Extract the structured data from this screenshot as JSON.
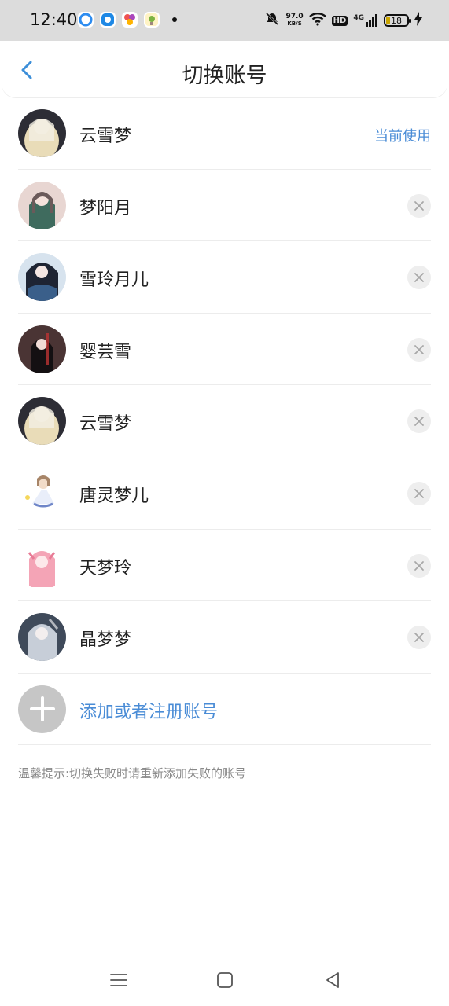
{
  "status_bar": {
    "time": "12:40",
    "speed_value": "97.0",
    "speed_unit": "KB/S",
    "hd_label": "HD",
    "network_label": "4G",
    "battery_level": "18"
  },
  "header": {
    "title": "切换账号"
  },
  "accounts": [
    {
      "name": "云雪梦",
      "status": "当前使用",
      "avatar_color": "#d8c39a"
    },
    {
      "name": "梦阳月",
      "avatar_color": "#4f7d6e"
    },
    {
      "name": "雪玲月儿",
      "avatar_color": "#3f4d72"
    },
    {
      "name": "婴芸雪",
      "avatar_color": "#3a2a2a"
    },
    {
      "name": "云雪梦",
      "avatar_color": "#d8c39a"
    },
    {
      "name": "唐灵梦儿",
      "avatar_color": "#c9d4ec"
    },
    {
      "name": "天梦玲",
      "avatar_color": "#f2a6b8"
    },
    {
      "name": "晶梦梦",
      "avatar_color": "#8896a8"
    }
  ],
  "add_account": {
    "label": "添加或者注册账号"
  },
  "tip": "温馨提示:切换失败时请重新添加失败的账号",
  "colors": {
    "accent": "#4a8cd6",
    "divider": "#ececec",
    "status_bar_bg": "#dcdcdc"
  }
}
